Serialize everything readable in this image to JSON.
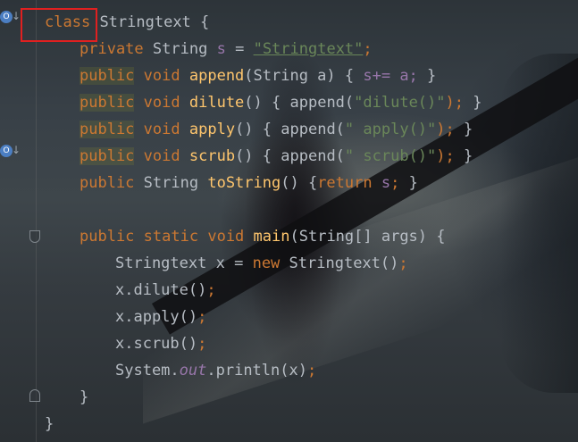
{
  "code_lines": [
    {
      "kw1": "class",
      "name": "Stringtext",
      "brace": "{"
    },
    {
      "kw1": "private",
      "type": "String",
      "var": "s",
      "eq": "=",
      "str": "\"Stringtext\"",
      "semi": ";"
    },
    {
      "kw1": "public",
      "kw2": "void",
      "fn": "append",
      "params": "(String a) {",
      "body": "s+= a;",
      "close": "}"
    },
    {
      "kw1": "public",
      "kw2": "void",
      "fn": "dilute",
      "params": "() {",
      "call": "append(",
      "str": "\"dilute()\"",
      "end": ");",
      "close": "}"
    },
    {
      "kw1": "public",
      "kw2": "void",
      "fn": "apply",
      "params": "() {",
      "call": "append(",
      "str": "\" apply()\"",
      "end": ");",
      "close": "}"
    },
    {
      "kw1": "public",
      "kw2": "void",
      "fn": "scrub",
      "params": "() {",
      "call": "append(",
      "str": "\" scrub()\"",
      "end": ");",
      "close": "}"
    },
    {
      "kw1": "public",
      "type": "String",
      "fn": "toString",
      "params": "() {",
      "ret": "return",
      "var": "s",
      "end": ";",
      "close": "}"
    },
    {
      "kw1": "public",
      "kw2": "static",
      "kw3": "void",
      "fn": "main",
      "params": "(String[] args) {"
    },
    {
      "type": "Stringtext",
      "rest": "x =",
      "kw1": "new",
      "call": "Stringtext()",
      "semi": ";"
    },
    {
      "call": "x.dilute()",
      "semi": ";"
    },
    {
      "call": "x.apply()",
      "semi": ";"
    },
    {
      "call": "x.scrub()",
      "semi": ";"
    },
    {
      "pre": "System.",
      "field": "out",
      "call": ".println(x)",
      "semi": ";"
    },
    {
      "close": "}"
    },
    {
      "close": "}"
    }
  ],
  "gutter": {
    "override_marker": "O",
    "arrow": "↓"
  },
  "colors": {
    "keyword": "#cc7832",
    "function": "#ffc66d",
    "string": "#6a8759",
    "field": "#9876aa",
    "plain": "#b7bdc4",
    "highlight_box": "#e02020"
  }
}
